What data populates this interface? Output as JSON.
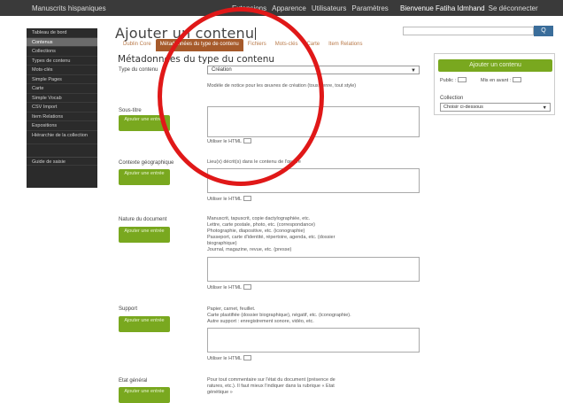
{
  "topbar": {
    "site": "Manuscrits hispaniques",
    "menu": [
      "Extensions",
      "Apparence",
      "Utilisateurs",
      "Paramètres"
    ],
    "user": "Bienvenue Fatiha Idmhand",
    "logout": "Se déconnecter"
  },
  "sidebar": {
    "items": [
      {
        "label": "Tableau de bord"
      },
      {
        "label": "Contenus"
      },
      {
        "label": "Collections"
      },
      {
        "label": "Types de contenu"
      },
      {
        "label": "Mots-clés"
      },
      {
        "label": "Simple Pages"
      },
      {
        "label": "Carte"
      },
      {
        "label": "Simple Vocab"
      },
      {
        "label": "CSV Import"
      },
      {
        "label": "Item Relations"
      },
      {
        "label": "Expositions"
      },
      {
        "label": "Hiérarchie de la collection"
      }
    ],
    "guide": "Guide de saisie"
  },
  "header": {
    "title": "Ajouter un contenu",
    "search_button": "Q"
  },
  "tabs": [
    "Dublin Core",
    "Métadonnées du type de contenu",
    "Fichiers",
    "Mots-clés",
    "Carte",
    "Item Relations"
  ],
  "section_title": "Métadonnées du type du contenu",
  "type_field": {
    "label": "Type du contenu",
    "value": "Création",
    "help": "Modèle de notice pour les œuvres de création (tous genre, tout style)"
  },
  "fields": [
    {
      "label": "Sous-titre",
      "button": "Ajouter une entrée",
      "help": []
    },
    {
      "label": "Contexte géographique",
      "button": "Ajouter une entrée",
      "help": [
        "Lieu(x) décrit(s) dans le contenu de l'œuvre"
      ]
    },
    {
      "label": "Nature du document",
      "button": "Ajouter une entrée",
      "help": [
        "Manuscrit, tapuscrit, copie dactylographiée, etc.",
        "Lettre, carte postale, photo, etc. (correspondance)",
        "Photographie, diapositive, etc. (iconographie)",
        "Passeport, carte d'identité, répertoire, agenda, etc. (dossier",
        "biographique)",
        "Journal, magazine, revue, etc. (presse)"
      ]
    },
    {
      "label": "Support",
      "button": "Ajouter une entrée",
      "help": [
        "Papier, carnet, feuillet.",
        "Carte plastifiée (dossier biographique), négatif, etc. (iconographie).",
        "Autre support : enregistrement sonore, vidéo, etc."
      ]
    },
    {
      "label": "Etat général",
      "button": "Ajouter une entrée",
      "help": [
        "Pour tout commentaire sur l'état du document (présence de",
        "ratures, etc.). Il faut mieux l'indiquer dans la rubrique « Etat",
        "génétique »"
      ]
    }
  ],
  "html_check_label": "Utiliser le HTML",
  "panel": {
    "button": "Ajouter un contenu",
    "public_label": "Public :",
    "featured_label": "Mis en avant :",
    "collection_label": "Collection",
    "collection_value": "Choisir ci-dessous"
  }
}
